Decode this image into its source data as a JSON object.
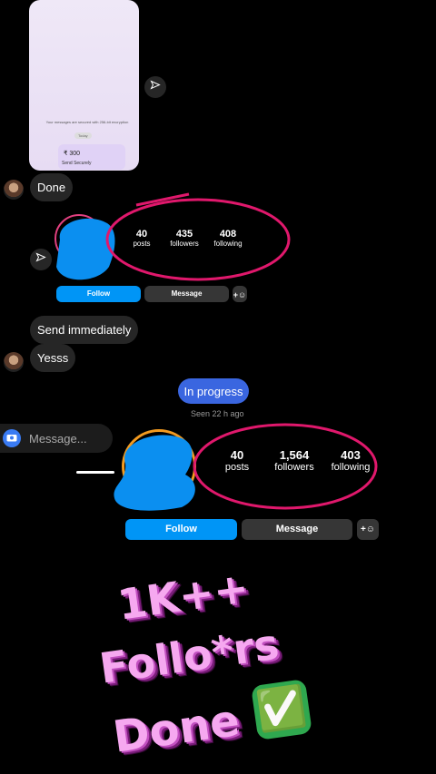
{
  "screenshot": {
    "secure_note": "Your messages are secured with 256-bit encryption",
    "today_label": "Today",
    "amount": "₹ 300",
    "send_label": "Send Securely"
  },
  "messages": {
    "done": "Done",
    "send_immediately": "Send immediately",
    "yesss": "Yesss",
    "in_progress": "In progress",
    "seen": "Seen 22 h ago"
  },
  "profile_before": {
    "posts_num": "40",
    "posts_label": "posts",
    "followers_num": "435",
    "followers_label": "followers",
    "following_num": "408",
    "following_label": "following",
    "follow_label": "Follow",
    "message_label": "Message"
  },
  "profile_after": {
    "posts_num": "40",
    "posts_label": "posts",
    "followers_num": "1,564",
    "followers_label": "followers",
    "following_num": "403",
    "following_label": "following",
    "follow_label": "Follow",
    "message_label": "Message"
  },
  "composer": {
    "placeholder": "Message..."
  },
  "overlay": {
    "line1": "1K++",
    "line2": "Follo*rs",
    "line3": "Done",
    "check": "✅"
  },
  "colors": {
    "follow_blue": "#0095f6",
    "annotation_pink": "#e0186c",
    "scribble_blue": "#0b8ff0",
    "overlay_pink": "#f6a8f0"
  }
}
